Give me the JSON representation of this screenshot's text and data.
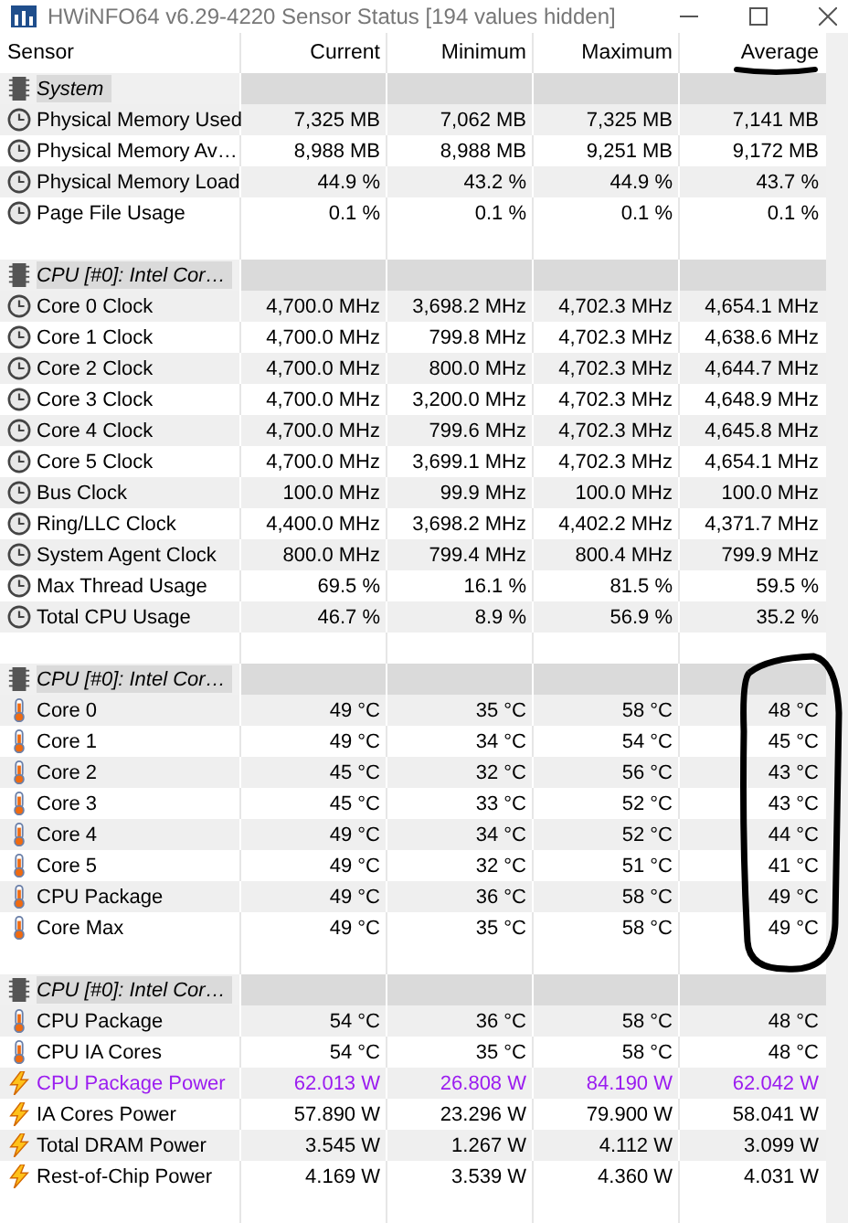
{
  "window": {
    "title": "HWiNFO64 v6.29-4220 Sensor Status [194 values hidden]"
  },
  "columns": [
    "Sensor",
    "Current",
    "Minimum",
    "Maximum",
    "Average"
  ],
  "groups": [
    {
      "label": "System",
      "rows": [
        {
          "kind": "clock",
          "sensor": "Physical Memory Used",
          "values": [
            "7,325 MB",
            "7,062 MB",
            "7,325 MB",
            "7,141 MB"
          ],
          "highlighted": false
        },
        {
          "kind": "clock",
          "sensor": "Physical Memory Av…",
          "values": [
            "8,988 MB",
            "8,988 MB",
            "9,251 MB",
            "9,172 MB"
          ],
          "highlighted": false
        },
        {
          "kind": "clock",
          "sensor": "Physical Memory Load",
          "values": [
            "44.9 %",
            "43.2 %",
            "44.9 %",
            "43.7 %"
          ],
          "highlighted": false
        },
        {
          "kind": "clock",
          "sensor": "Page File Usage",
          "values": [
            "0.1 %",
            "0.1 %",
            "0.1 %",
            "0.1 %"
          ],
          "highlighted": false
        }
      ]
    },
    {
      "label": "CPU [#0]: Intel Cor…",
      "rows": [
        {
          "kind": "clock",
          "sensor": "Core 0 Clock",
          "values": [
            "4,700.0 MHz",
            "3,698.2 MHz",
            "4,702.3 MHz",
            "4,654.1 MHz"
          ],
          "highlighted": false
        },
        {
          "kind": "clock",
          "sensor": "Core 1 Clock",
          "values": [
            "4,700.0 MHz",
            "799.8 MHz",
            "4,702.3 MHz",
            "4,638.6 MHz"
          ],
          "highlighted": false
        },
        {
          "kind": "clock",
          "sensor": "Core 2 Clock",
          "values": [
            "4,700.0 MHz",
            "800.0 MHz",
            "4,702.3 MHz",
            "4,644.7 MHz"
          ],
          "highlighted": false
        },
        {
          "kind": "clock",
          "sensor": "Core 3 Clock",
          "values": [
            "4,700.0 MHz",
            "3,200.0 MHz",
            "4,702.3 MHz",
            "4,648.9 MHz"
          ],
          "highlighted": false
        },
        {
          "kind": "clock",
          "sensor": "Core 4 Clock",
          "values": [
            "4,700.0 MHz",
            "799.6 MHz",
            "4,702.3 MHz",
            "4,645.8 MHz"
          ],
          "highlighted": false
        },
        {
          "kind": "clock",
          "sensor": "Core 5 Clock",
          "values": [
            "4,700.0 MHz",
            "3,699.1 MHz",
            "4,702.3 MHz",
            "4,654.1 MHz"
          ],
          "highlighted": false
        },
        {
          "kind": "clock",
          "sensor": "Bus Clock",
          "values": [
            "100.0 MHz",
            "99.9 MHz",
            "100.0 MHz",
            "100.0 MHz"
          ],
          "highlighted": false
        },
        {
          "kind": "clock",
          "sensor": "Ring/LLC Clock",
          "values": [
            "4,400.0 MHz",
            "3,698.2 MHz",
            "4,402.2 MHz",
            "4,371.7 MHz"
          ],
          "highlighted": false
        },
        {
          "kind": "clock",
          "sensor": "System Agent Clock",
          "values": [
            "800.0 MHz",
            "799.4 MHz",
            "800.4 MHz",
            "799.9 MHz"
          ],
          "highlighted": false
        },
        {
          "kind": "clock",
          "sensor": "Max Thread Usage",
          "values": [
            "69.5 %",
            "16.1 %",
            "81.5 %",
            "59.5 %"
          ],
          "highlighted": false
        },
        {
          "kind": "clock",
          "sensor": "Total CPU Usage",
          "values": [
            "46.7 %",
            "8.9 %",
            "56.9 %",
            "35.2 %"
          ],
          "highlighted": false
        }
      ]
    },
    {
      "label": "CPU [#0]: Intel Cor…",
      "rows": [
        {
          "kind": "thermometer",
          "sensor": "Core 0",
          "values": [
            "49 °C",
            "35 °C",
            "58 °C",
            "48 °C"
          ],
          "highlighted": false
        },
        {
          "kind": "thermometer",
          "sensor": "Core 1",
          "values": [
            "49 °C",
            "34 °C",
            "54 °C",
            "45 °C"
          ],
          "highlighted": false
        },
        {
          "kind": "thermometer",
          "sensor": "Core 2",
          "values": [
            "45 °C",
            "32 °C",
            "56 °C",
            "43 °C"
          ],
          "highlighted": false
        },
        {
          "kind": "thermometer",
          "sensor": "Core 3",
          "values": [
            "45 °C",
            "33 °C",
            "52 °C",
            "43 °C"
          ],
          "highlighted": false
        },
        {
          "kind": "thermometer",
          "sensor": "Core 4",
          "values": [
            "49 °C",
            "34 °C",
            "52 °C",
            "44 °C"
          ],
          "highlighted": false
        },
        {
          "kind": "thermometer",
          "sensor": "Core 5",
          "values": [
            "49 °C",
            "32 °C",
            "51 °C",
            "41 °C"
          ],
          "highlighted": false
        },
        {
          "kind": "thermometer",
          "sensor": "CPU Package",
          "values": [
            "49 °C",
            "36 °C",
            "58 °C",
            "49 °C"
          ],
          "highlighted": false
        },
        {
          "kind": "thermometer",
          "sensor": "Core Max",
          "values": [
            "49 °C",
            "35 °C",
            "58 °C",
            "49 °C"
          ],
          "highlighted": false
        }
      ]
    },
    {
      "label": "CPU [#0]: Intel Cor…",
      "rows": [
        {
          "kind": "thermometer",
          "sensor": "CPU Package",
          "values": [
            "54 °C",
            "36 °C",
            "58 °C",
            "48 °C"
          ],
          "highlighted": false
        },
        {
          "kind": "thermometer",
          "sensor": "CPU IA Cores",
          "values": [
            "54 °C",
            "35 °C",
            "58 °C",
            "48 °C"
          ],
          "highlighted": false
        },
        {
          "kind": "bolt",
          "sensor": "CPU Package Power",
          "values": [
            "62.013 W",
            "26.808 W",
            "84.190 W",
            "62.042 W"
          ],
          "highlighted": true
        },
        {
          "kind": "bolt",
          "sensor": "IA Cores Power",
          "values": [
            "57.890 W",
            "23.296 W",
            "79.900 W",
            "58.041 W"
          ],
          "highlighted": false
        },
        {
          "kind": "bolt",
          "sensor": "Total DRAM Power",
          "values": [
            "3.545 W",
            "1.267 W",
            "4.112 W",
            "3.099 W"
          ],
          "highlighted": false
        },
        {
          "kind": "bolt",
          "sensor": "Rest-of-Chip Power",
          "values": [
            "4.169 W",
            "3.539 W",
            "4.360 W",
            "4.031 W"
          ],
          "highlighted": false
        }
      ]
    }
  ],
  "pen_marks": {
    "average_underlined": true,
    "average_circled": true
  }
}
